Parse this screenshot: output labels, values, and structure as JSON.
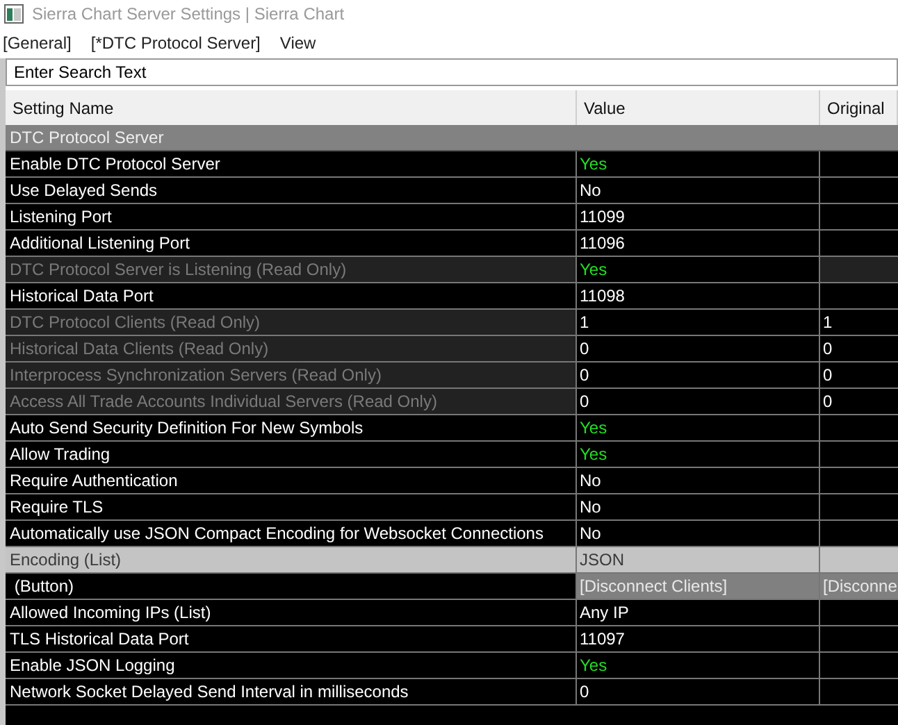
{
  "window": {
    "title": "Sierra Chart Server Settings | Sierra Chart"
  },
  "menu": [
    {
      "label": "[General]"
    },
    {
      "label": "[*DTC Protocol Server]"
    },
    {
      "label": "View"
    }
  ],
  "search": {
    "placeholder": "Enter Search Text"
  },
  "table": {
    "columns": [
      "Setting Name",
      "Value",
      "Original"
    ],
    "group": "DTC Protocol Server",
    "rows": [
      {
        "kind": "setting",
        "name": "Enable DTC Protocol Server",
        "value": "Yes",
        "value_on": true
      },
      {
        "kind": "setting",
        "name": "Use Delayed Sends",
        "value": "No",
        "value_on": false
      },
      {
        "kind": "setting",
        "name": "Listening Port",
        "value": "11099",
        "value_on": false
      },
      {
        "kind": "setting",
        "name": "Additional Listening Port",
        "value": "11096",
        "value_on": false
      },
      {
        "kind": "read_only",
        "name": "DTC Protocol Server is Listening (Read Only)",
        "value": "Yes",
        "value_on": true
      },
      {
        "kind": "setting",
        "name": "Historical Data Port",
        "value": "11098",
        "value_on": false
      },
      {
        "kind": "read_only",
        "name": "DTC Protocol Clients (Read Only)",
        "value": "1",
        "value_on": false,
        "original": "1"
      },
      {
        "kind": "read_only",
        "name": "Historical Data Clients (Read Only)",
        "value": "0",
        "value_on": false,
        "original": "0"
      },
      {
        "kind": "read_only",
        "name": "Interprocess Synchronization Servers (Read Only)",
        "value": "0",
        "value_on": false,
        "original": "0"
      },
      {
        "kind": "read_only",
        "name": "Access All Trade Accounts Individual Servers (Read Only)",
        "value": "0",
        "value_on": false,
        "original": "0"
      },
      {
        "kind": "setting",
        "name": "Auto Send Security Definition For New Symbols",
        "value": "Yes",
        "value_on": true
      },
      {
        "kind": "setting",
        "name": "Allow Trading",
        "value": "Yes",
        "value_on": true
      },
      {
        "kind": "setting",
        "name": "Require Authentication",
        "value": "No",
        "value_on": false
      },
      {
        "kind": "setting",
        "name": "Require TLS",
        "value": "No",
        "value_on": false
      },
      {
        "kind": "setting",
        "name": "Automatically use JSON Compact Encoding for Websocket Connections",
        "value": "No",
        "value_on": false
      },
      {
        "kind": "selected",
        "name": "Encoding (List)",
        "value": "JSON",
        "value_on": false
      },
      {
        "kind": "button",
        "name": " (Button)",
        "value": "[Disconnect Clients]",
        "value_on": false,
        "original": "[Disconne"
      },
      {
        "kind": "setting",
        "name": "Allowed Incoming IPs (List)",
        "value": "Any IP",
        "value_on": false
      },
      {
        "kind": "setting",
        "name": "TLS Historical Data Port",
        "value": "11097",
        "value_on": false
      },
      {
        "kind": "setting",
        "name": "Enable JSON Logging",
        "value": "Yes",
        "value_on": true
      },
      {
        "kind": "setting",
        "name": "Network Socket Delayed Send Interval in milliseconds",
        "value": "0",
        "value_on": false
      }
    ]
  }
}
